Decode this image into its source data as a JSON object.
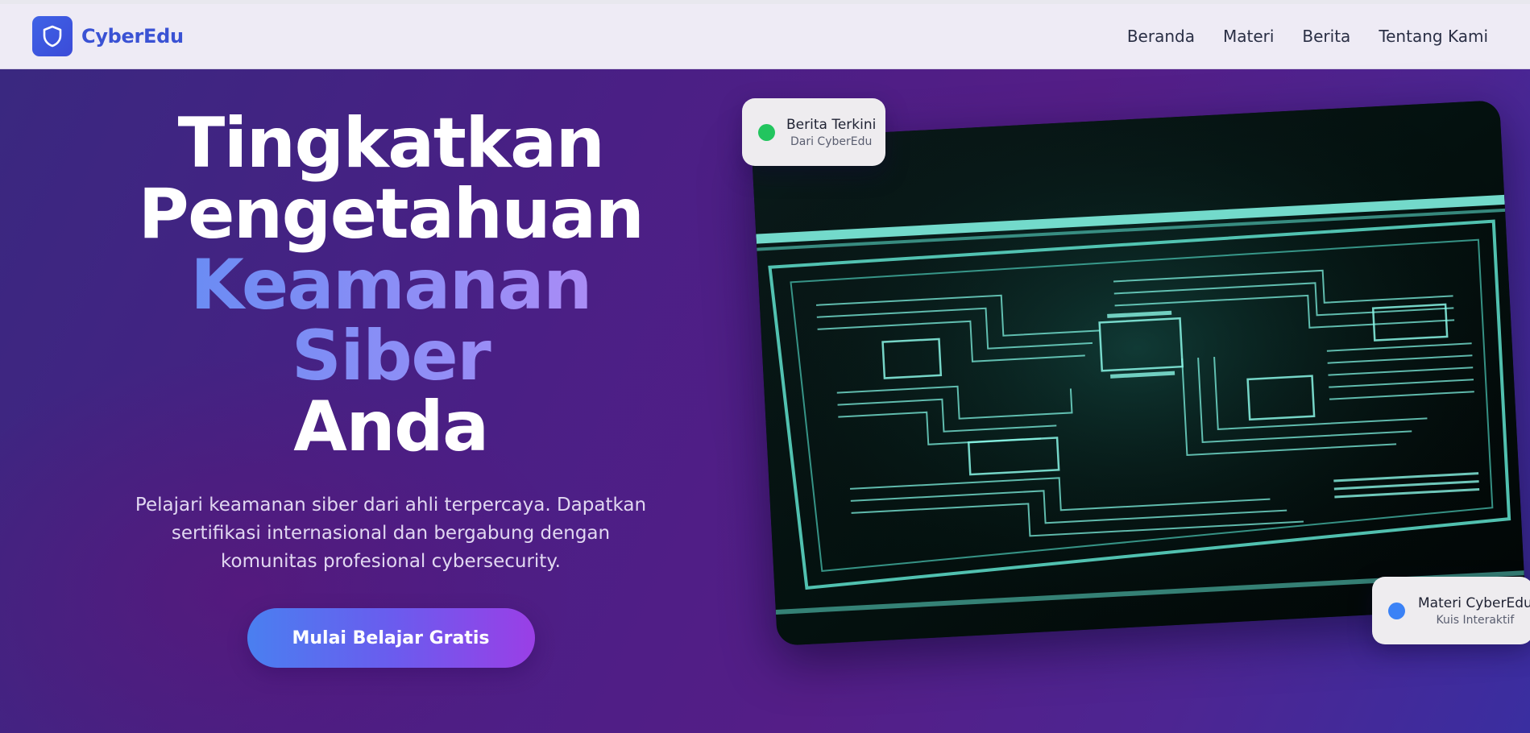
{
  "brand": {
    "name": "CyberEdu",
    "logo_icon": "shield-icon",
    "accent": "#3a52d4"
  },
  "nav": {
    "items": [
      {
        "label": "Beranda"
      },
      {
        "label": "Materi"
      },
      {
        "label": "Berita"
      },
      {
        "label": "Tentang Kami"
      }
    ]
  },
  "hero": {
    "title_line1": "Tingkatkan",
    "title_line2": "Pengetahuan",
    "title_highlight": "Keamanan Siber",
    "title_line4": "Anda",
    "subtitle": "Pelajari keamanan siber dari ahli terpercaya. Dapatkan sertifikasi internasional dan bergabung dengan komunitas profesional cybersecurity.",
    "cta_label": "Mulai Belajar Gratis"
  },
  "badges": {
    "news": {
      "title": "Berita Terkini",
      "subtitle": "Dari CyberEdu",
      "status_color": "#22c55e"
    },
    "material": {
      "title": "Materi CyberEdu",
      "subtitle": "Kuis Interaktif",
      "status_color": "#3b82f6"
    }
  }
}
